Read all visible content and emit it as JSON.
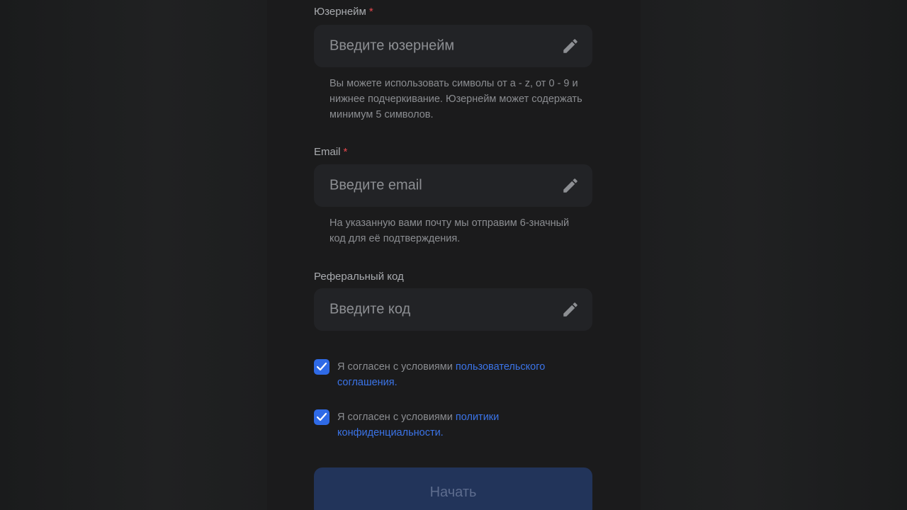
{
  "form": {
    "username": {
      "label": "Юзернейм",
      "required_mark": "*",
      "placeholder": "Введите юзернейм",
      "hint": "Вы можете использовать символы от a - z, от 0 - 9 и нижнее подчеркивание. Юзернейм может содержать минимум 5 символов.",
      "icon": "pencil-icon"
    },
    "email": {
      "label": "Email",
      "required_mark": "*",
      "placeholder": "Введите email",
      "hint": "На указанную вами почту мы отправим 6-значный код для её подтверждения.",
      "icon": "pencil-icon"
    },
    "referral": {
      "label": "Реферальный код",
      "placeholder": "Введите код",
      "icon": "pencil-icon"
    },
    "agreements": [
      {
        "text": "Я согласен с условиями ",
        "link": "пользовательского соглашения.",
        "checked": true
      },
      {
        "text": "Я согласен с условиями ",
        "link": "политики конфиденциальности.",
        "checked": true
      }
    ],
    "submit_label": "Начать"
  },
  "colors": {
    "accent": "#2f6ae6",
    "link": "#3b74e8",
    "required": "#e5484d",
    "field_bg": "#222326",
    "button_bg": "#22345a"
  }
}
